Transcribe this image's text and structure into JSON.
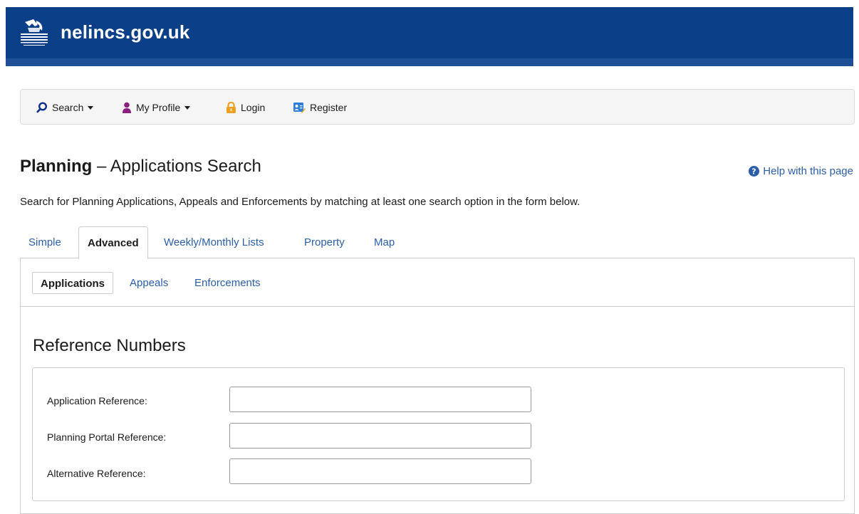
{
  "header": {
    "site_name": "nelincs.gov.uk",
    "logo_icon": "council-crest-icon",
    "brand_color": "#0b4088"
  },
  "nav": {
    "items": [
      {
        "label": "Search",
        "icon": "search-icon",
        "has_dropdown": true
      },
      {
        "label": "My Profile",
        "icon": "user-icon",
        "has_dropdown": true
      },
      {
        "label": "Login",
        "icon": "lock-icon",
        "has_dropdown": false
      },
      {
        "label": "Register",
        "icon": "register-icon",
        "has_dropdown": false
      }
    ]
  },
  "page": {
    "title_strong": "Planning",
    "title_rest": " – Applications Search",
    "help_label": "Help with this page",
    "intro": "Search for Planning Applications, Appeals and Enforcements by matching at least one search option in the form below."
  },
  "tabs": [
    {
      "label": "Simple",
      "active": false
    },
    {
      "label": "Advanced",
      "active": true
    },
    {
      "label": "Weekly/Monthly Lists",
      "active": false
    },
    {
      "label": "Property",
      "active": false
    },
    {
      "label": "Map",
      "active": false
    }
  ],
  "subtabs": [
    {
      "label": "Applications",
      "active": true
    },
    {
      "label": "Appeals",
      "active": false
    },
    {
      "label": "Enforcements",
      "active": false
    }
  ],
  "reference_section": {
    "title": "Reference Numbers",
    "fields": [
      {
        "label": "Application Reference:",
        "value": "",
        "placeholder": ""
      },
      {
        "label": "Planning Portal Reference:",
        "value": "",
        "placeholder": ""
      },
      {
        "label": "Alternative Reference:",
        "value": "",
        "placeholder": ""
      }
    ]
  }
}
